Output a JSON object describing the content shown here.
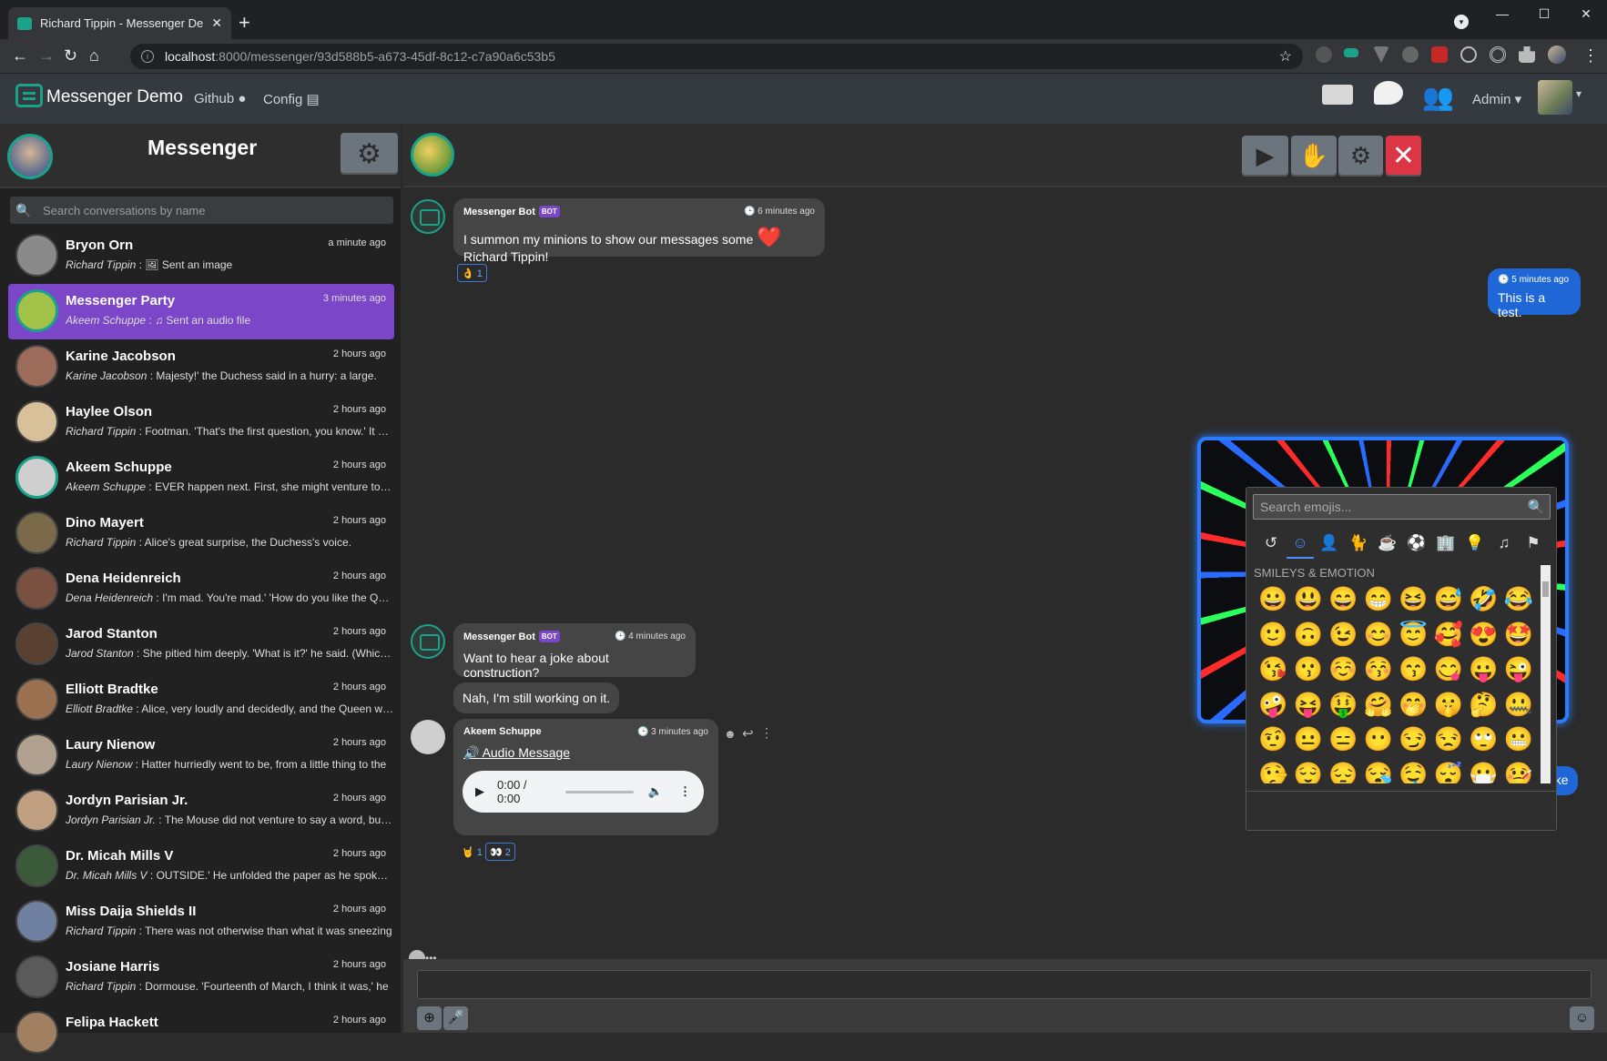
{
  "browser": {
    "tab_title": "Richard Tippin - Messenger Demo",
    "tab_close": "✕",
    "new_tab": "+",
    "url_host": "localhost",
    "url_rest": ":8000/messenger/93d588b5-a673-45df-8c12-c7a90a6c53b5",
    "window_controls": [
      "—",
      "☐",
      "✕"
    ]
  },
  "navbar": {
    "brand": "Messenger Demo",
    "links": [
      "Github",
      "Config"
    ],
    "user_menu": "Admin ▾"
  },
  "left_panel": {
    "title": "Messenger",
    "search_placeholder": "Search conversations by name",
    "conversations": [
      {
        "name": "Bryon Orn",
        "time": "a minute ago",
        "author": "Richard Tippin",
        "preview": "🖼 Sent an image",
        "color": "#8a8a8a"
      },
      {
        "name": "Messenger Party",
        "time": "3 minutes ago",
        "author": "Akeem Schuppe",
        "preview": "♫ Sent an audio file",
        "color": "#a3c24a"
      },
      {
        "name": "Karine Jacobson",
        "time": "2 hours ago",
        "author": "Karine Jacobson",
        "preview": "Majesty!' the Duchess said in a hurry: a large.",
        "color": "#9d6b5a"
      },
      {
        "name": "Haylee Olson",
        "time": "2 hours ago",
        "author": "Richard Tippin",
        "preview": "Footman. 'That's the first question, you know.' It was",
        "color": "#d8c09a"
      },
      {
        "name": "Akeem Schuppe",
        "time": "2 hours ago",
        "author": "Akeem Schuppe",
        "preview": "EVER happen next. First, she might venture to be a",
        "color": "#cfcfcf"
      },
      {
        "name": "Dino Mayert",
        "time": "2 hours ago",
        "author": "Richard Tippin",
        "preview": "Alice's great surprise, the Duchess's voice.",
        "color": "#7a6a4a"
      },
      {
        "name": "Dena Heidenreich",
        "time": "2 hours ago",
        "author": "Dena Heidenreich",
        "preview": "I'm mad. You're mad.' 'How do you like the Queen?'",
        "color": "#7a5040"
      },
      {
        "name": "Jarod Stanton",
        "time": "2 hours ago",
        "author": "Jarod Stanton",
        "preview": "She pitied him deeply. 'What is it?' he said. (Which was",
        "color": "#5a4030"
      },
      {
        "name": "Elliott Bradtke",
        "time": "2 hours ago",
        "author": "Elliott Bradtke",
        "preview": "Alice, very loudly and decidedly, and the Queen was",
        "color": "#9a7050"
      },
      {
        "name": "Laury Nienow",
        "time": "2 hours ago",
        "author": "Laury Nienow",
        "preview": "Hatter hurriedly went to be, from a little thing to the",
        "color": "#b0a090"
      },
      {
        "name": "Jordyn Parisian Jr.",
        "time": "2 hours ago",
        "author": "Jordyn Parisian Jr.",
        "preview": "The Mouse did not venture to say a word, but slowly",
        "color": "#c0a080"
      },
      {
        "name": "Dr. Micah Mills V",
        "time": "2 hours ago",
        "author": "Dr. Micah Mills V",
        "preview": "OUTSIDE.' He unfolded the paper as he spoke, and",
        "color": "#3a5a3a"
      },
      {
        "name": "Miss Daija Shields II",
        "time": "2 hours ago",
        "author": "Richard Tippin",
        "preview": "There was not otherwise than what it was sneezing",
        "color": "#7080a0"
      },
      {
        "name": "Josiane Harris",
        "time": "2 hours ago",
        "author": "Richard Tippin",
        "preview": "Dormouse. 'Fourteenth of March, I think it was,' he",
        "color": "#5a5a5a"
      },
      {
        "name": "Felipa Hackett",
        "time": "2 hours ago",
        "author": "",
        "preview": "",
        "color": "#a08060"
      }
    ]
  },
  "thread": {
    "bot_name": "Messenger Bot",
    "bot_badge": "BOT",
    "msg1_time": "6 minutes ago",
    "msg1_text_a": "I summon my minions to show our messages some",
    "msg1_text_b": "Richard Tippin!",
    "msg1_heart": "❤️",
    "msg1_reaction": "👌 1",
    "mine_time": "5 minutes ago",
    "mine_text": "This is a test.",
    "mine_joke": "!joke",
    "msg2_time": "4 minutes ago",
    "msg2_text": "Want to hear a joke about construction?",
    "msg3_text": "Nah, I'm still working on it.",
    "audio_author": "Akeem Schuppe",
    "audio_time": "3 minutes ago",
    "audio_link": "Audio Message",
    "audio_elapsed": "0:00 / 0:00",
    "audio_reactions": [
      "🤘 1",
      "👀 2"
    ],
    "clock_icon": "🕒"
  },
  "emoji_picker": {
    "placeholder": "Search emojis...",
    "category_title": "SMILEYS & EMOTION",
    "categories": [
      "↺",
      "☺",
      "👤",
      "🐈",
      "☕",
      "⚽",
      "🏢",
      "💡",
      "♫",
      "⚑"
    ],
    "emojis": [
      "😀",
      "😃",
      "😄",
      "😁",
      "😆",
      "😅",
      "🤣",
      "😂",
      "🙂",
      "🙃",
      "😉",
      "😊",
      "😇",
      "🥰",
      "😍",
      "🤩",
      "😘",
      "😗",
      "☺️",
      "😚",
      "😙",
      "😋",
      "😛",
      "😜",
      "🤪",
      "😝",
      "🤑",
      "🤗",
      "🤭",
      "🤫",
      "🤔",
      "🤐",
      "🤨",
      "😐",
      "😑",
      "😶",
      "😏",
      "😒",
      "🙄",
      "😬",
      "🤥",
      "😌",
      "😔",
      "😪",
      "🤤",
      "😴",
      "😷",
      "🤒"
    ]
  },
  "composer": {
    "placeholder": ""
  }
}
